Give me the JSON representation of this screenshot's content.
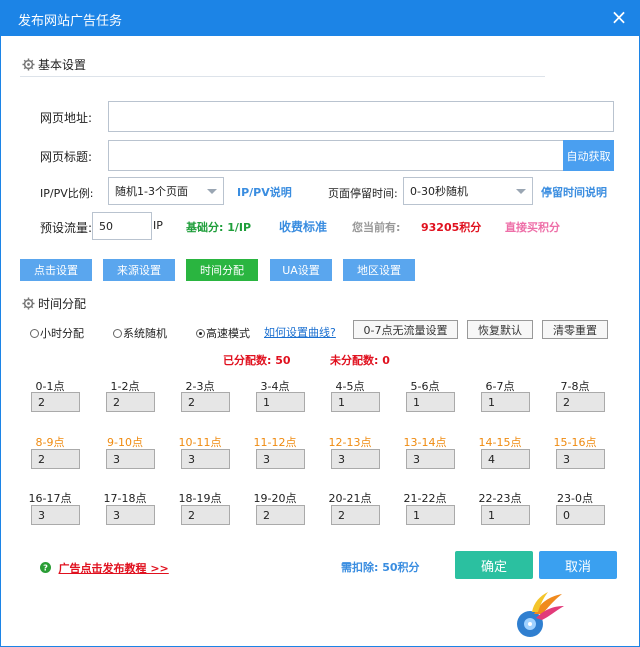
{
  "window": {
    "title": "发布网站广告任务",
    "close": "×"
  },
  "basic": {
    "heading": "基本设置",
    "url_label": "网页地址:",
    "url_value": "",
    "page_title_label": "网页标题:",
    "page_title_value": "",
    "auto_fetch": "自动获取",
    "ippv_label": "IP/PV比例:",
    "ippv_value": "随机1-3个页面",
    "ippv_help": "IP/PV说明",
    "stay_label": "页面停留时间:",
    "stay_value": "0-30秒随机",
    "stay_help": "停留时间说明",
    "traffic_label": "预设流量:",
    "traffic_value": "50",
    "traffic_unit": "IP",
    "base_score": "基础分: 1/IP",
    "fee_link": "收费标准",
    "current_label": "您当前有:",
    "current_points": "93205积分",
    "buy_link": "直接买积分"
  },
  "tabs": [
    "点击设置",
    "来源设置",
    "时间分配",
    "UA设置",
    "地区设置"
  ],
  "time": {
    "heading": "时间分配",
    "modes": [
      "小时分配",
      "系统随机",
      "高速模式"
    ],
    "curve_link": "如何设置曲线?",
    "btn_no_traffic": "0-7点无流量设置",
    "btn_restore": "恢复默认",
    "btn_clear": "清零重置",
    "assigned_label": "已分配数: 50",
    "unassigned_label": "未分配数: 0",
    "rows": [
      [
        {
          "label": "0-1点",
          "value": "2"
        },
        {
          "label": "1-2点",
          "value": "2"
        },
        {
          "label": "2-3点",
          "value": "2"
        },
        {
          "label": "3-4点",
          "value": "1"
        },
        {
          "label": "4-5点",
          "value": "1"
        },
        {
          "label": "5-6点",
          "value": "1"
        },
        {
          "label": "6-7点",
          "value": "1"
        },
        {
          "label": "7-8点",
          "value": "2"
        }
      ],
      [
        {
          "label": "8-9点",
          "value": "2"
        },
        {
          "label": "9-10点",
          "value": "3"
        },
        {
          "label": "10-11点",
          "value": "3"
        },
        {
          "label": "11-12点",
          "value": "3"
        },
        {
          "label": "12-13点",
          "value": "3"
        },
        {
          "label": "13-14点",
          "value": "3"
        },
        {
          "label": "14-15点",
          "value": "4"
        },
        {
          "label": "15-16点",
          "value": "3"
        }
      ],
      [
        {
          "label": "16-17点",
          "value": "3"
        },
        {
          "label": "17-18点",
          "value": "3"
        },
        {
          "label": "18-19点",
          "value": "2"
        },
        {
          "label": "19-20点",
          "value": "2"
        },
        {
          "label": "20-21点",
          "value": "2"
        },
        {
          "label": "21-22点",
          "value": "1"
        },
        {
          "label": "22-23点",
          "value": "1"
        },
        {
          "label": "23-0点",
          "value": "0"
        }
      ]
    ],
    "highlight_color": "#ef8a0f"
  },
  "footer": {
    "tutorial": "广告点击发布教程 >>",
    "deduct": "需扣除: 50积分",
    "ok": "确定",
    "cancel": "取消"
  }
}
